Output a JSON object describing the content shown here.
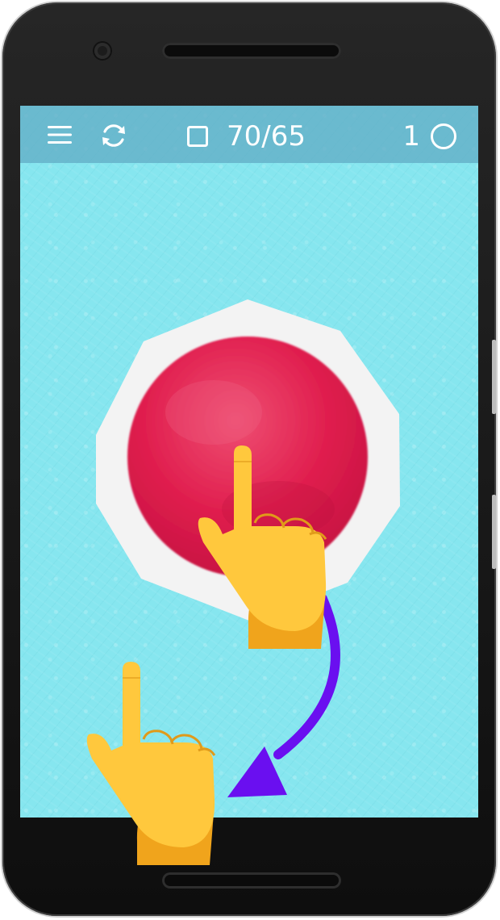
{
  "topbar": {
    "menu_icon": "hamburger-menu-icon",
    "restart_icon": "refresh-icon",
    "goal_icon": "square-outline-icon",
    "level_progress": "70/65",
    "score": "1",
    "score_icon": "circle-outline-icon"
  },
  "game": {
    "shape": "octagon",
    "ball_color": "#e01e4e",
    "frame_color": "#f3f3f3",
    "background_color": "#86e6ef",
    "arrow_color": "#6a0ff0"
  },
  "tutorial": {
    "gesture": "drag-down-left",
    "start_hand_icon": "pointing-up-hand-icon",
    "end_hand_icon": "pointing-up-hand-icon"
  }
}
